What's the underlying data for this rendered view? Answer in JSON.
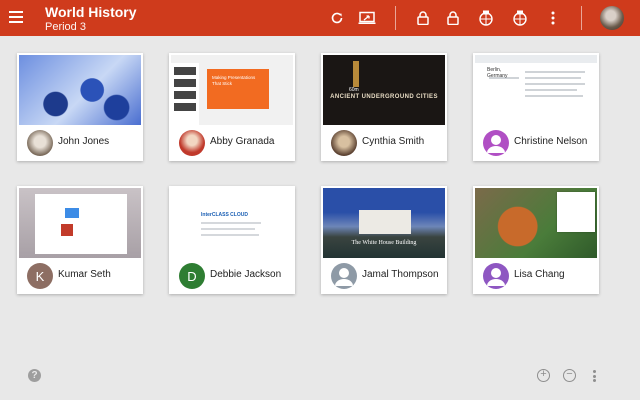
{
  "header": {
    "title": "World History",
    "subtitle": "Period 3",
    "menu_icon": "hamburger-menu-icon",
    "tools": [
      "refresh-icon",
      "screen-share-icon",
      "lock-icon",
      "lock-icon",
      "globe-lock-icon",
      "globe-lock-icon",
      "more-vert-icon"
    ],
    "accent_color": "#cf3b1c"
  },
  "students": [
    {
      "name": "John Jones",
      "avatar_type": "photo"
    },
    {
      "name": "Abby Granada",
      "avatar_type": "photo"
    },
    {
      "name": "Cynthia Smith",
      "avatar_type": "photo"
    },
    {
      "name": "Christine Nelson",
      "avatar_type": "generic",
      "avatar_color": "#b04fc4"
    },
    {
      "name": "Kumar Seth",
      "avatar_type": "initial",
      "initial": "K",
      "avatar_color": "#8d6e63"
    },
    {
      "name": "Debbie Jackson",
      "avatar_type": "initial",
      "initial": "D",
      "avatar_color": "#2e7d32"
    },
    {
      "name": "Jamal Thompson",
      "avatar_type": "generic",
      "avatar_color": "#8e9aa6"
    },
    {
      "name": "Lisa Chang",
      "avatar_type": "generic",
      "avatar_color": "#8e57c2"
    }
  ],
  "thumbnails": {
    "slides": {
      "headline": "Making Presentations That Stick"
    },
    "ancient": {
      "year": "60m",
      "title": "ANCIENT UNDERGROUND CITIES"
    },
    "docs": {
      "title": "Berlin, Germany"
    },
    "class": {
      "title": "InterCLASS CLOUD"
    },
    "whitehouse": {
      "caption": "The White House Building"
    }
  },
  "footer": {
    "help": "?",
    "zoom_in": "+",
    "zoom_out": "−"
  }
}
